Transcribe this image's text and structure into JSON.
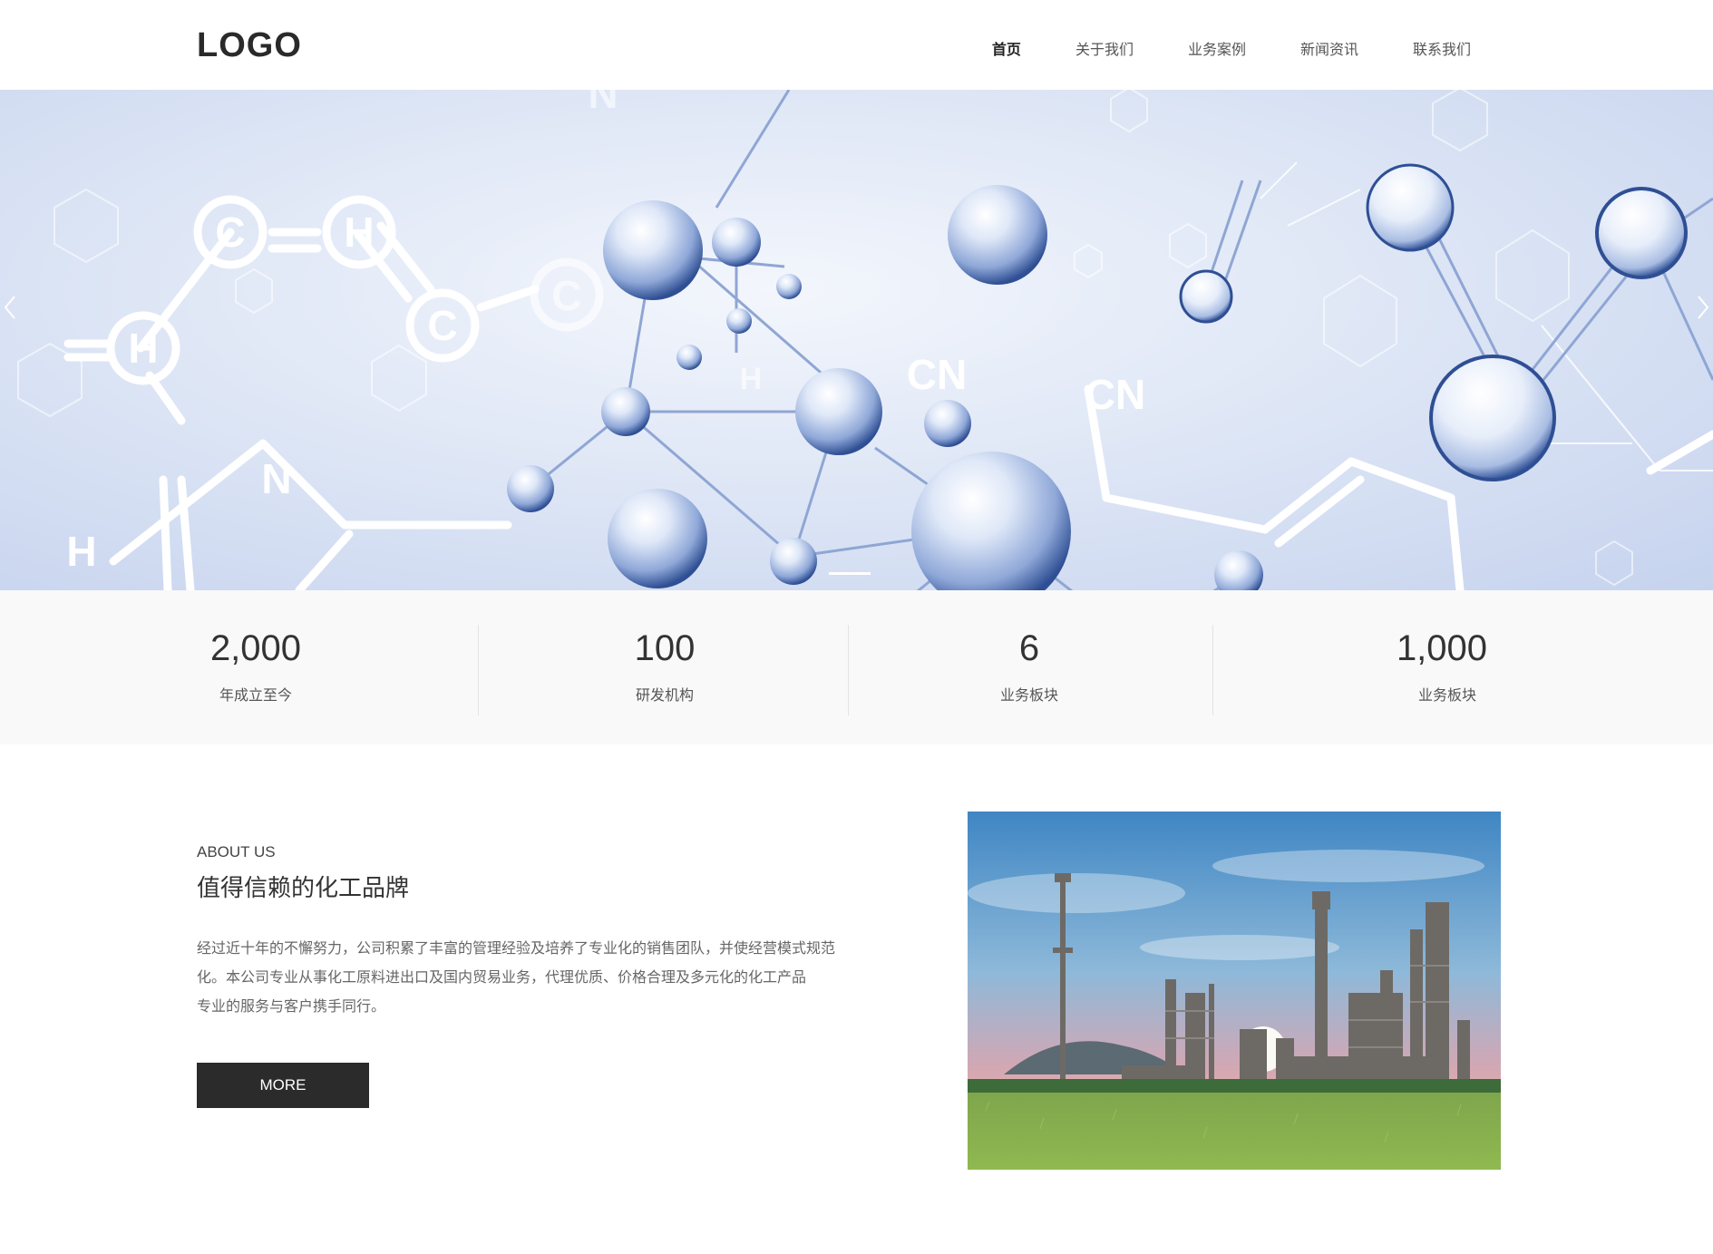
{
  "header": {
    "logo": "LOGO",
    "nav": [
      {
        "label": "首页",
        "active": true
      },
      {
        "label": "关于我们",
        "active": false
      },
      {
        "label": "业务案例",
        "active": false
      },
      {
        "label": "新闻资讯",
        "active": false
      },
      {
        "label": "联系我们",
        "active": false
      }
    ]
  },
  "banner": {
    "molecule_labels": [
      "C",
      "H",
      "C",
      "C",
      "H",
      "N",
      "CN",
      "CN",
      "H",
      "H",
      "H",
      "H",
      "N"
    ],
    "prev_icon": "chevron-left-icon",
    "next_icon": "chevron-right-icon",
    "colors": {
      "bg_light": "#f3f6fc",
      "bg_dark": "#c6d3ee",
      "sphere": "#4a70b8"
    }
  },
  "stats": [
    {
      "value": "2,000",
      "label": "年成立至今"
    },
    {
      "value": "100",
      "label": "研发机构"
    },
    {
      "value": "6",
      "label": "业务板块"
    },
    {
      "value": "1,000",
      "label": "业务板块"
    }
  ],
  "about": {
    "subtitle_en": "ABOUT US",
    "title": "值得信赖的化工品牌",
    "lines": [
      "经过近十年的不懈努力，公司积累了丰富的管理经验及培养了专业化的销售团队，并使经营模式规范",
      "化。本公司专业从事化工原料进出口及国内贸易业务，代理优质、价格合理及多元化的化工产品",
      "专业的服务与客户携手同行。"
    ],
    "button": "MORE"
  },
  "colors": {
    "button_bg": "#2b2b2b",
    "stats_bg": "#f9f9f9"
  }
}
